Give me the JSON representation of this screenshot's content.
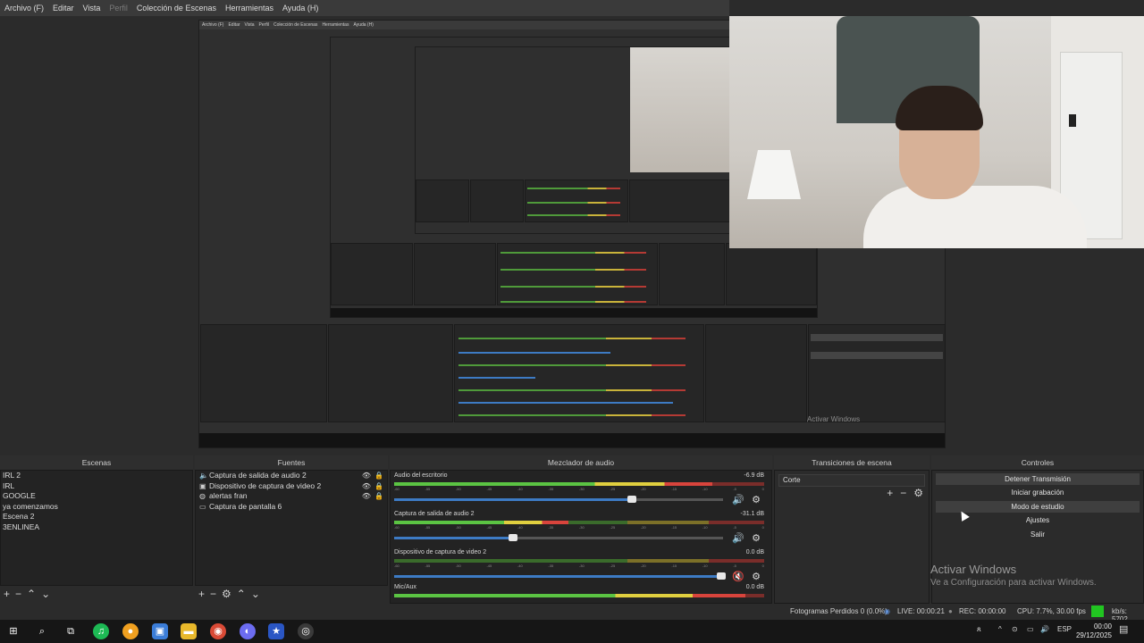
{
  "menu": [
    "Archivo (F)",
    "Editar",
    "Vista",
    "Perfil",
    "Colección de Escenas",
    "Herramientas",
    "Ayuda (H)"
  ],
  "docks": {
    "scenes_title": "Escenas",
    "sources_title": "Fuentes",
    "mixer_title": "Mezclador de audio",
    "transitions_title": "Transiciones de escena",
    "controls_title": "Controles"
  },
  "scenes": [
    "IRL 2",
    "IRL",
    "GOOGLE",
    "ya comenzamos",
    "Escena 2",
    "3ENLINEA"
  ],
  "sources": [
    {
      "name": "Captura de salida de audio 2",
      "icon": "speaker-icon"
    },
    {
      "name": "Dispositivo de captura de video 2",
      "icon": "camera-icon"
    },
    {
      "name": "alertas fran",
      "icon": "globe-icon"
    },
    {
      "name": "Captura de pantalla 6",
      "icon": "monitor-icon"
    }
  ],
  "mixer": [
    {
      "name": "Audio del escritorio",
      "db": "-6.9 dB",
      "level": 0.86,
      "volume": 0.72,
      "muted": false
    },
    {
      "name": "Captura de salida de audio 2",
      "db": "-31.1 dB",
      "level": 0.47,
      "volume": 0.36,
      "muted": false
    },
    {
      "name": "Dispositivo de captura de video 2",
      "db": "0.0 dB",
      "level": 0.0,
      "volume": 0.99,
      "muted": true
    },
    {
      "name": "Mic/Aux",
      "db": "0.0 dB",
      "level": 0.95,
      "volume": 0.99,
      "muted": false
    }
  ],
  "mixer_ticks": [
    "-60",
    "-55",
    "-50",
    "-45",
    "-40",
    "-35",
    "-30",
    "-25",
    "-20",
    "-15",
    "-10",
    "-5",
    "0"
  ],
  "transitions": {
    "selected": "Corte"
  },
  "controls": [
    "Detener Transmisión",
    "Iniciar grabación",
    "Modo de estudio",
    "Ajustes",
    "Salir"
  ],
  "activation": {
    "line1": "Activar Windows",
    "line2": "Ve a Configuración para activar Windows."
  },
  "status": {
    "dropped": "Fotogramas Perdidos 0 (0.0%)",
    "live": "LIVE: 00:00:21",
    "rec": "REC: 00:00:00",
    "cpu": "CPU: 7.7%, 30.00 fps",
    "kbs": "kb/s: 5702"
  },
  "taskbar": {
    "lang": "ESP",
    "time": "00:00",
    "date": "29/12/2025"
  },
  "colors": {
    "accent": "#3d7bc4",
    "live_green": "#21c521",
    "muted_red": "#d23b3b"
  }
}
